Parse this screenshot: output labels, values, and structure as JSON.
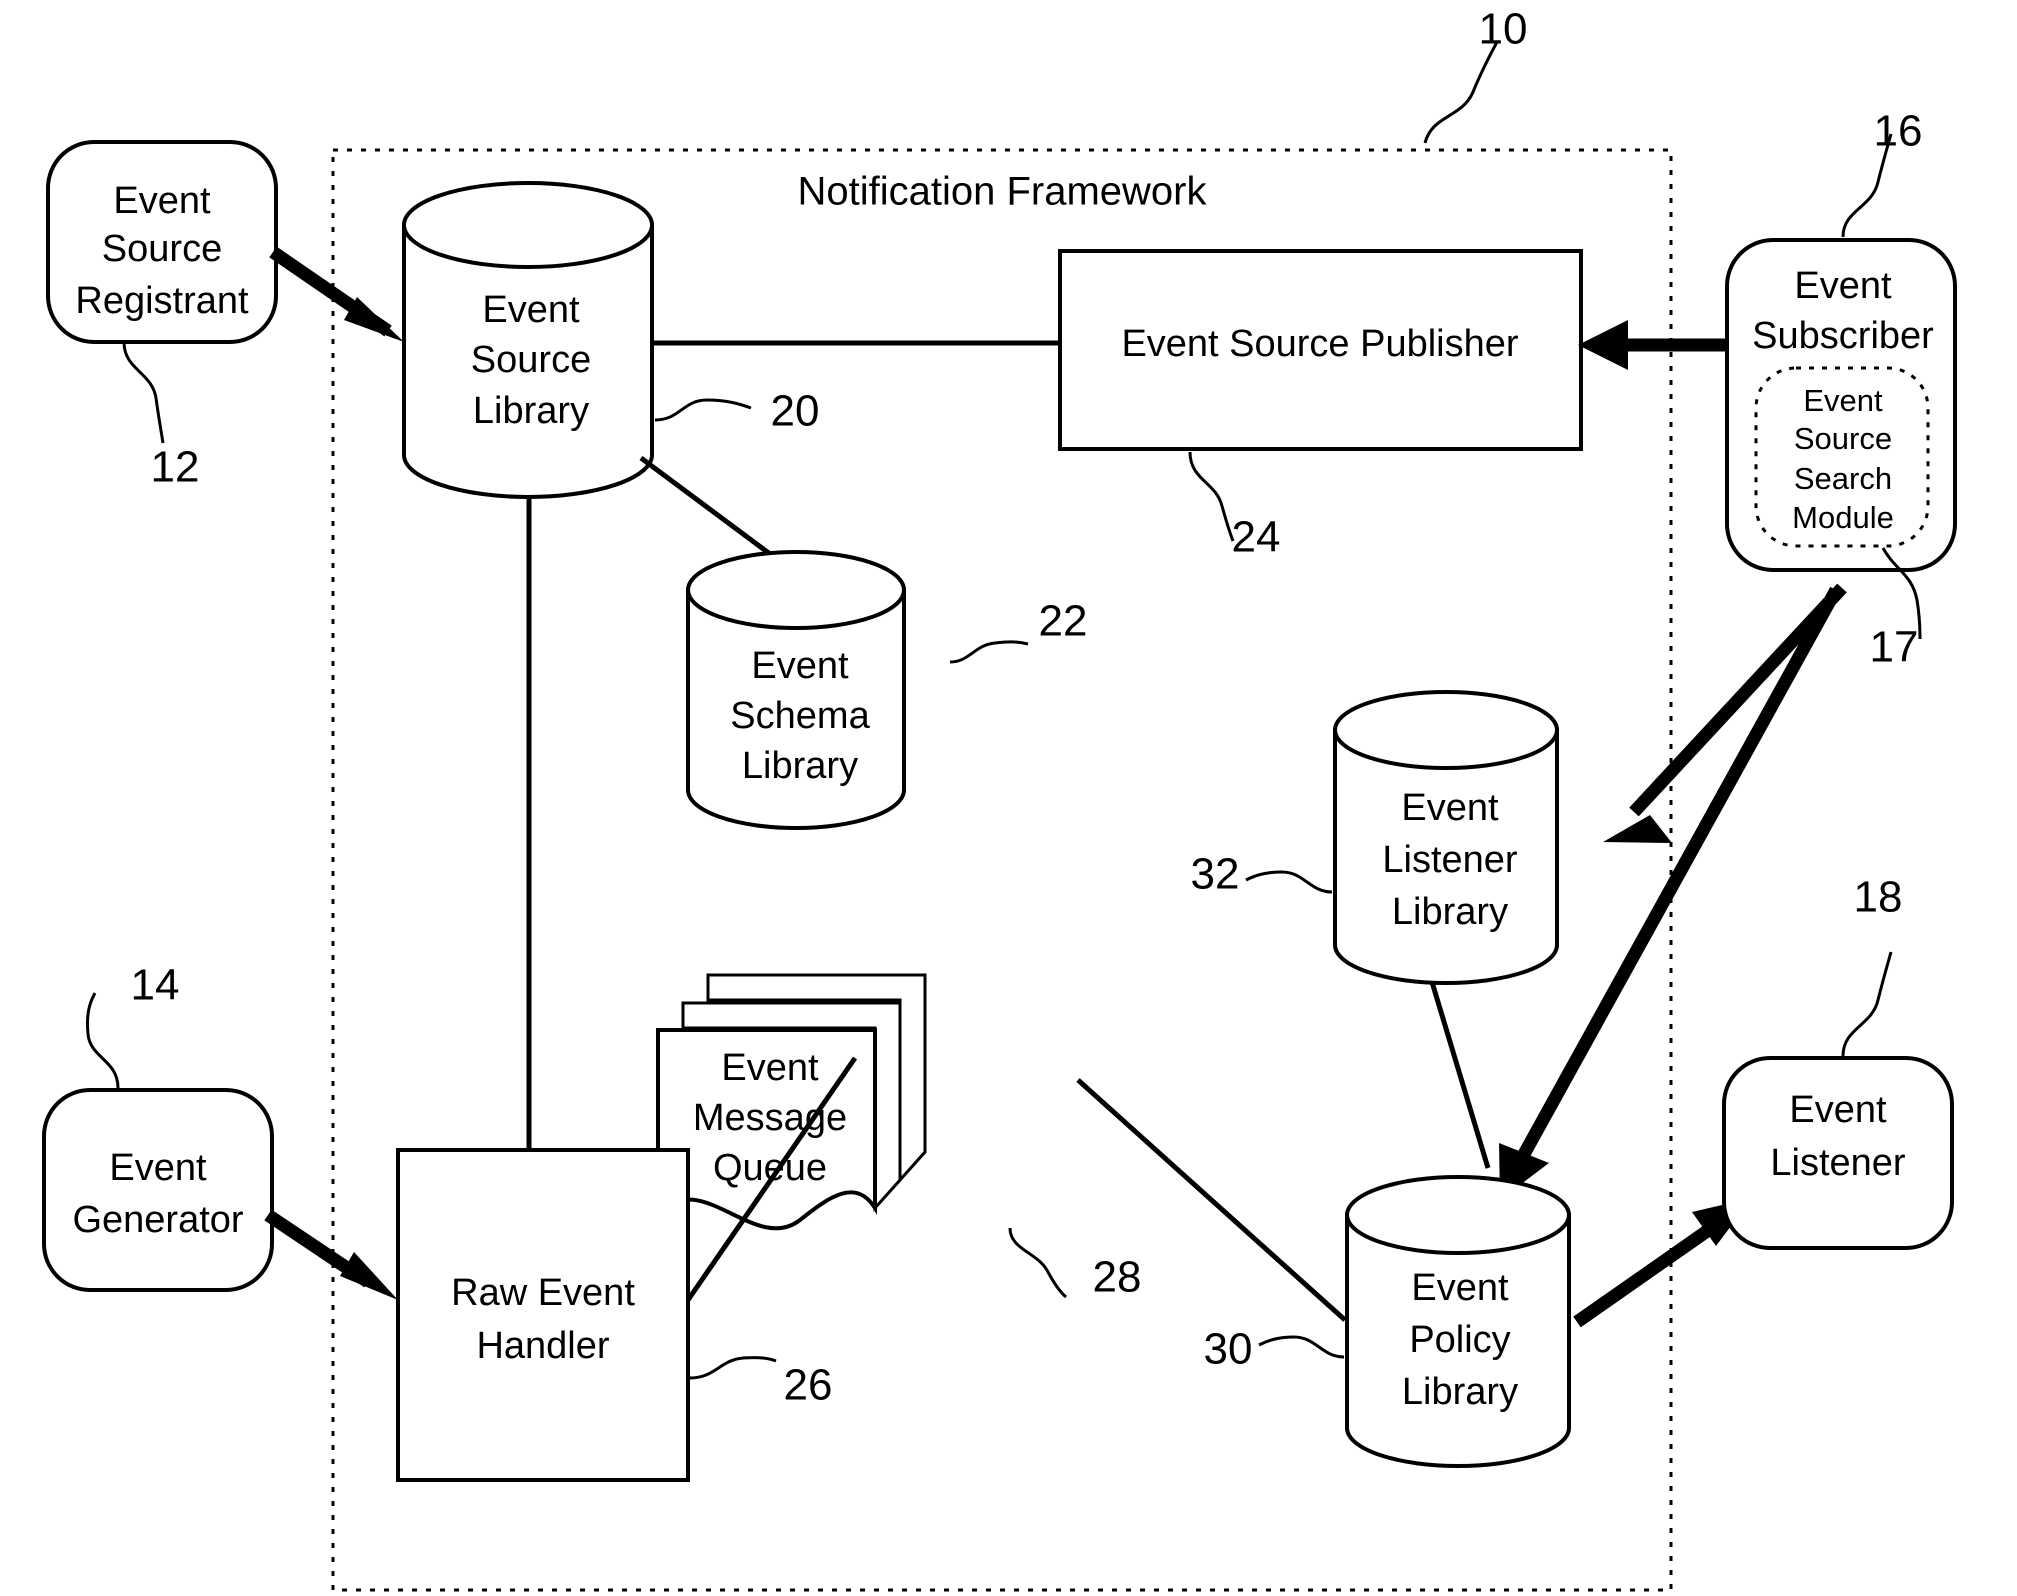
{
  "figure": {
    "frame_title": "Notification Framework",
    "frame_ref": "10",
    "nodes": {
      "event_source_registrant": {
        "label": "Event\nSource\nRegistrant",
        "line1": "Event",
        "line2": "Source",
        "line3": "Registrant",
        "ref": "12"
      },
      "event_generator": {
        "label": "Event\nGenerator",
        "line1": "Event",
        "line2": "Generator",
        "ref": "14"
      },
      "event_subscriber": {
        "line1": "Event",
        "line2": "Subscriber",
        "ref": "16"
      },
      "event_source_search_module": {
        "line1": "Event",
        "line2": "Source",
        "line3": "Search",
        "line4": "Module",
        "ref": "17"
      },
      "event_listener": {
        "line1": "Event",
        "line2": "Listener",
        "ref": "18"
      },
      "event_source_library": {
        "line1": "Event",
        "line2": "Source",
        "line3": "Library",
        "ref": "20"
      },
      "event_schema_library": {
        "line1": "Event",
        "line2": "Schema",
        "line3": "Library",
        "ref": "22"
      },
      "event_source_publisher": {
        "label": "Event Source Publisher",
        "ref": "24"
      },
      "raw_event_handler": {
        "line1": "Raw Event",
        "line2": "Handler",
        "ref": "26"
      },
      "event_message_queue": {
        "line1": "Event",
        "line2": "Message",
        "line3": "Queue",
        "ref": "28"
      },
      "event_policy_library": {
        "line1": "Event",
        "line2": "Policy",
        "line3": "Library",
        "ref": "30"
      },
      "event_listener_library": {
        "line1": "Event",
        "line2": "Listener",
        "line3": "Library",
        "ref": "32"
      }
    },
    "colors": {
      "ink": "#000000",
      "paper": "#ffffff"
    }
  }
}
